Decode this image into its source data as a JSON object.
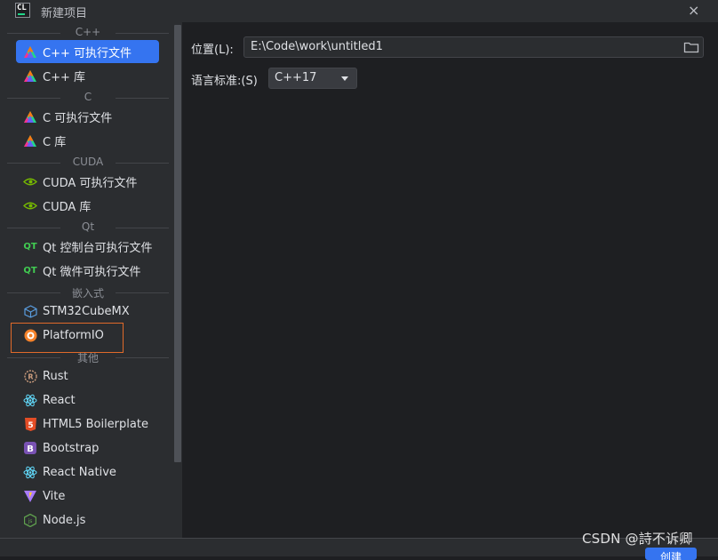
{
  "window": {
    "title": "新建项目",
    "app_icon_text": "CL",
    "close_glyph": "×"
  },
  "sidebar": {
    "groups": [
      {
        "header": "C++",
        "items": [
          {
            "label": "C++ 可执行文件",
            "icon": "clion-triangle-icon",
            "selected": true
          },
          {
            "label": "C++ 库",
            "icon": "clion-triangle-icon"
          }
        ]
      },
      {
        "header": "C",
        "items": [
          {
            "label": "C 可执行文件",
            "icon": "clion-triangle-icon"
          },
          {
            "label": "C 库",
            "icon": "clion-triangle-icon"
          }
        ]
      },
      {
        "header": "CUDA",
        "items": [
          {
            "label": "CUDA 可执行文件",
            "icon": "nvidia-eye-icon"
          },
          {
            "label": "CUDA 库",
            "icon": "nvidia-eye-icon"
          }
        ]
      },
      {
        "header": "Qt",
        "items": [
          {
            "label": "Qt 控制台可执行文件",
            "icon": "qt-icon"
          },
          {
            "label": "Qt 微件可执行文件",
            "icon": "qt-icon"
          }
        ]
      },
      {
        "header": "嵌入式",
        "items": [
          {
            "label": "STM32CubeMX",
            "icon": "cube-icon"
          },
          {
            "label": "PlatformIO",
            "icon": "platformio-icon"
          }
        ]
      },
      {
        "header": "其他",
        "items": [
          {
            "label": "Rust",
            "icon": "rust-icon"
          },
          {
            "label": "React",
            "icon": "react-icon"
          },
          {
            "label": "HTML5 Boilerplate",
            "icon": "html5-icon"
          },
          {
            "label": "Bootstrap",
            "icon": "bootstrap-icon"
          },
          {
            "label": "React Native",
            "icon": "react-icon"
          },
          {
            "label": "Vite",
            "icon": "vite-icon"
          },
          {
            "label": "Node.js",
            "icon": "nodejs-icon"
          }
        ]
      }
    ]
  },
  "form": {
    "location_label": "位置(L):",
    "location_value": "E:\\Code\\work\\untitled1",
    "std_label": "语言标准:(S)",
    "std_value": "C++17"
  },
  "footer": {
    "create_label": "创建"
  },
  "watermark": "CSDN @詩不诉卿",
  "colors": {
    "accent": "#3574f0",
    "background": "#1e1f22",
    "panel": "#2b2d30",
    "highlight": "#e06a2a"
  }
}
